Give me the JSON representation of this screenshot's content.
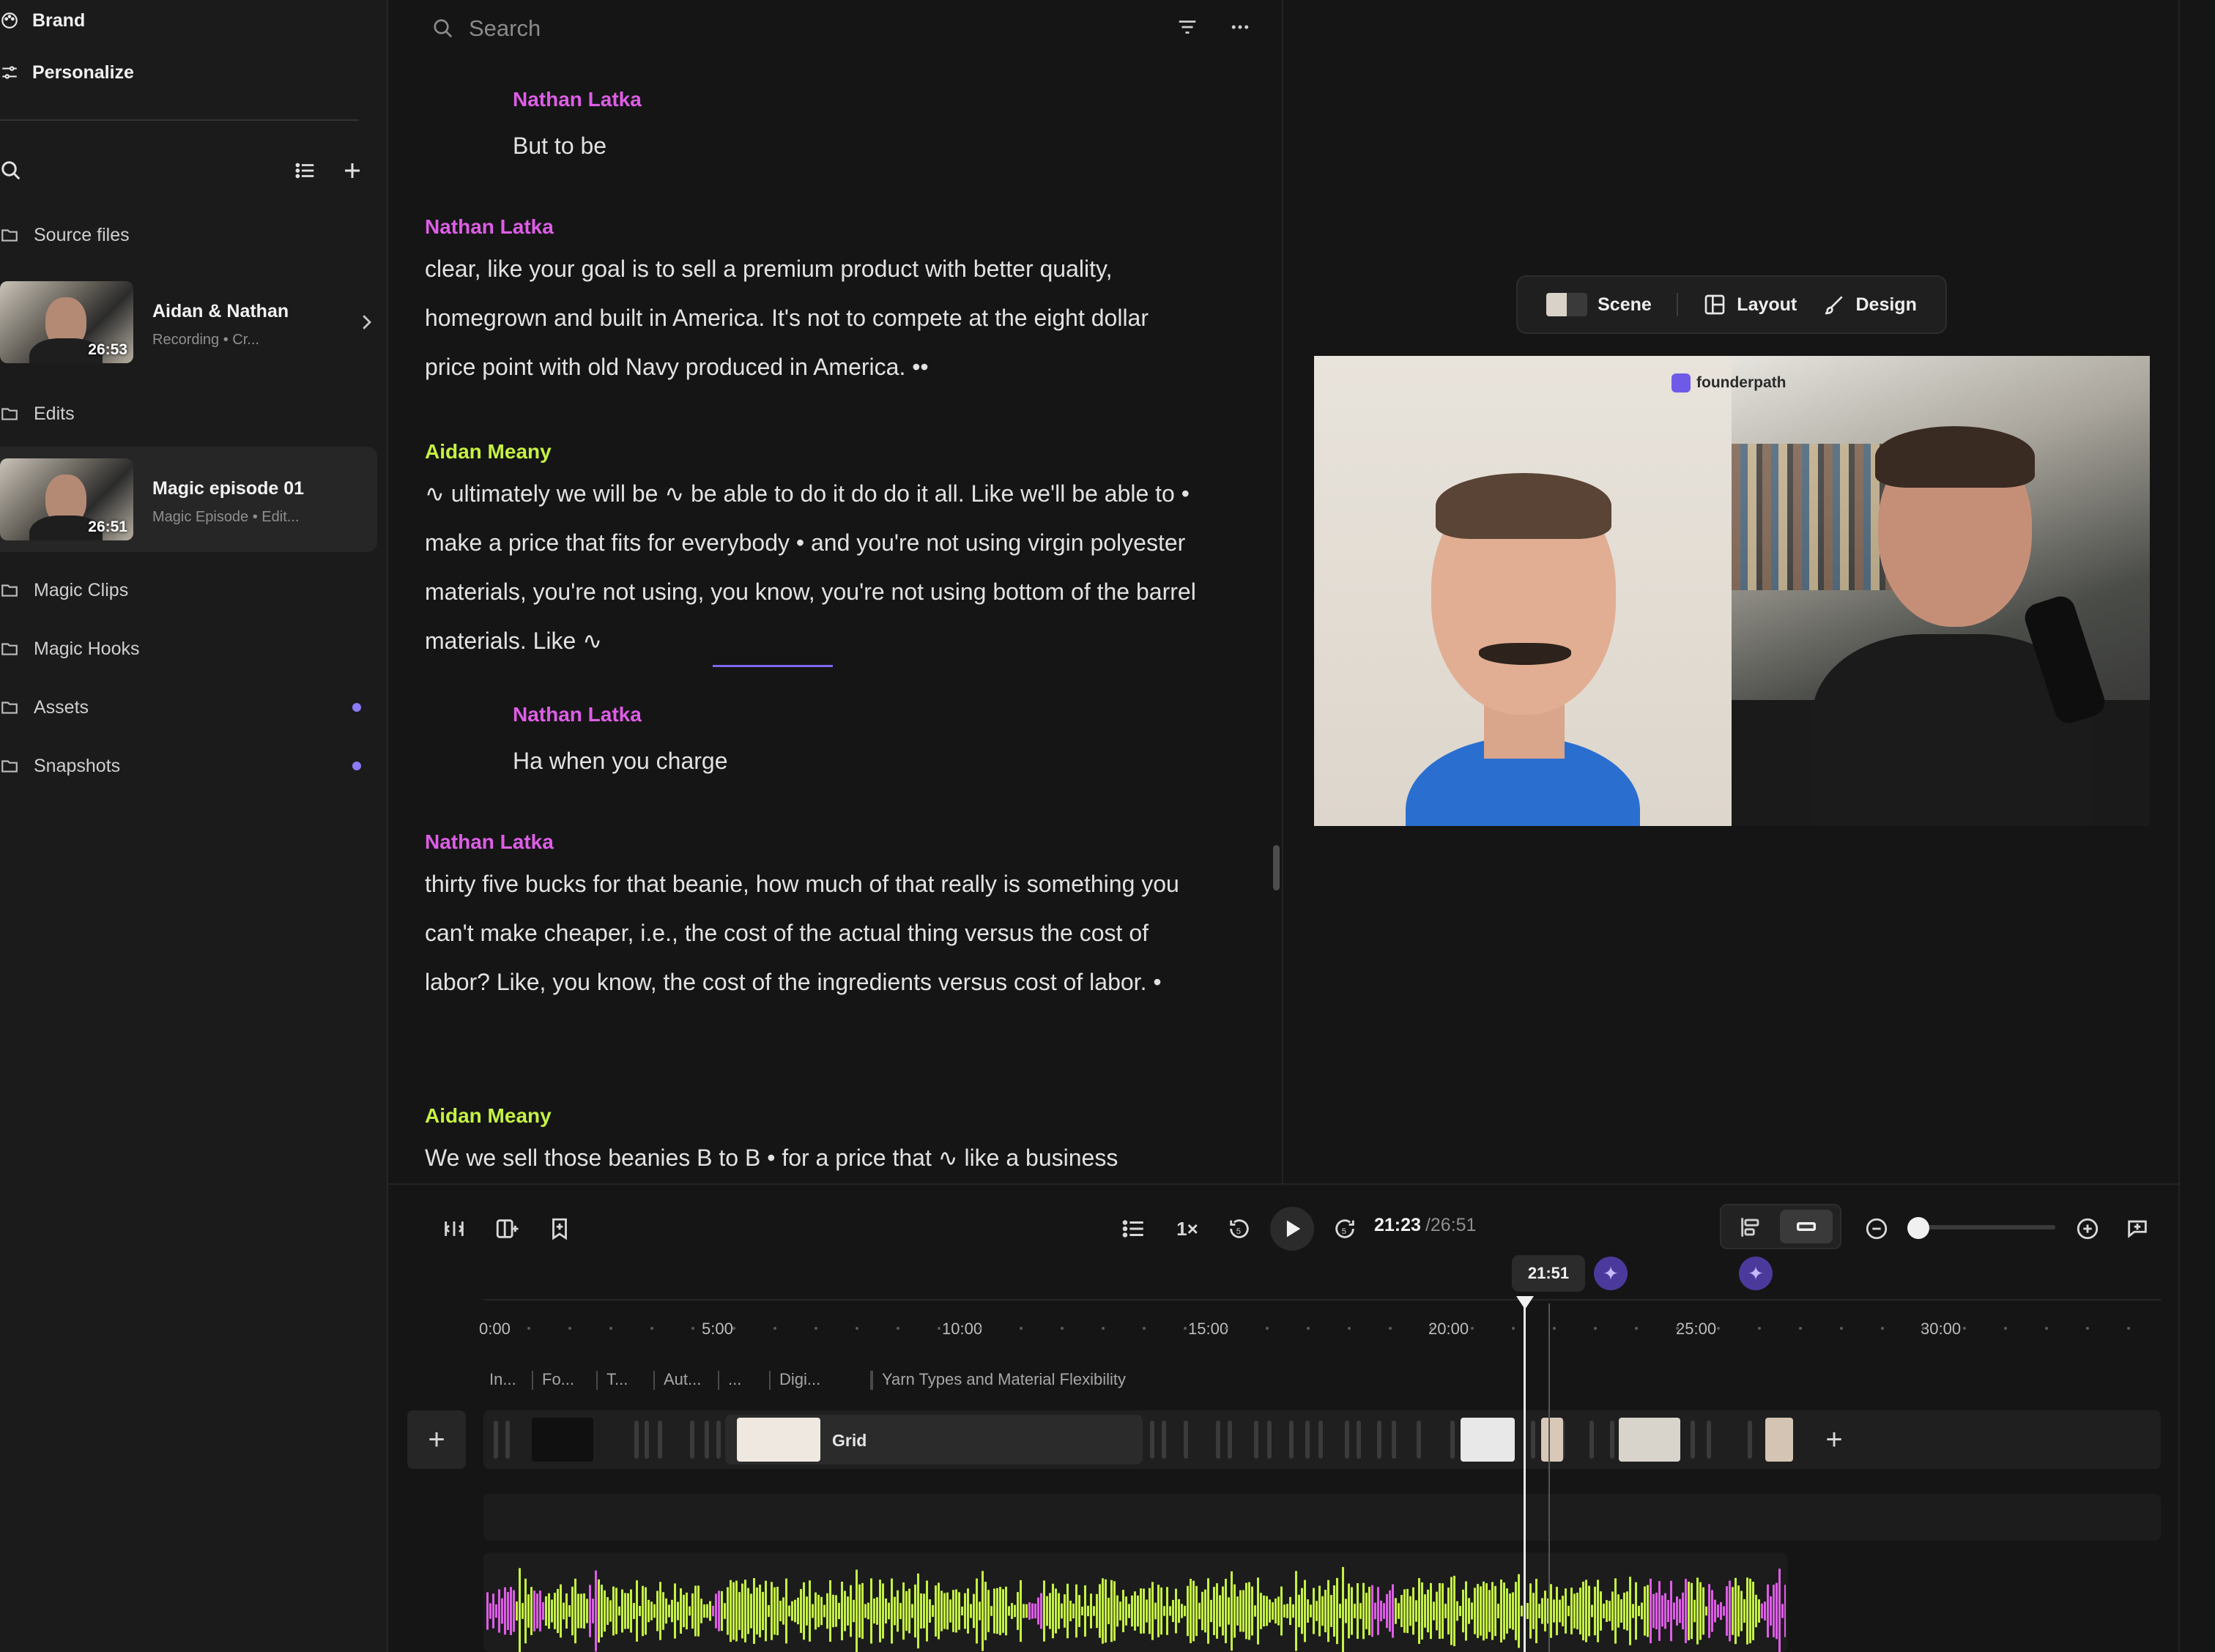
{
  "sidebar": {
    "top": [
      {
        "label": "Brand",
        "icon": "palette-icon"
      },
      {
        "label": "Personalize",
        "icon": "sliders-icon"
      }
    ],
    "sections": {
      "source_files": "Source files",
      "edits": "Edits",
      "magic_clips": "Magic Clips",
      "magic_hooks": "Magic Hooks",
      "assets": "Assets",
      "snapshots": "Snapshots"
    },
    "recording": {
      "title": "Aidan & Nathan",
      "subtitle": "Recording • Cr...",
      "duration": "26:53"
    },
    "edit_item": {
      "title": "Magic episode 01",
      "subtitle": "Magic Episode • Edit...",
      "duration": "26:51"
    }
  },
  "transcript": {
    "search_placeholder": "Search",
    "blocks": [
      {
        "speaker": "Nathan Latka",
        "text": "But to be",
        "indent": true,
        "color": "pink"
      },
      {
        "speaker": "Nathan Latka",
        "text": "clear, like your goal is to sell a premium product with better quality, homegrown and built in America. It's not to compete at the eight dollar price point with old Navy produced in America. ••",
        "indent": false,
        "color": "pink"
      },
      {
        "speaker": "Aidan Meany",
        "text": "∿ ultimately we will be ∿ be able to do it do do it all. Like we'll be able to • make a price that fits for everybody • and you're not using virgin polyester materials, you're not using, you know, you're not using bottom of the barrel materials. Like ∿",
        "indent": false,
        "color": "lime"
      },
      {
        "speaker": "Nathan Latka",
        "text": "Ha when you charge",
        "indent": true,
        "color": "pink"
      },
      {
        "speaker": "Nathan Latka",
        "text": "thirty five bucks for that beanie, how much of that really is something you can't make cheaper, i.e., the cost of the actual thing versus the cost of labor? Like, you know, the cost of the ingredients versus cost of labor. •",
        "indent": false,
        "color": "pink"
      },
      {
        "speaker": "Aidan Meany",
        "text": "We we sell those beanies B to B • for a price that ∿ like a business",
        "indent": false,
        "color": "lime"
      }
    ]
  },
  "preview": {
    "scene_label": "Scene",
    "layout_label": "Layout",
    "design_label": "Design",
    "brand_watermark": "founderpath"
  },
  "timeline": {
    "speed": "1×",
    "current_time": "21:23",
    "total_time": "/26:51",
    "hover_time": "21:51",
    "ruler": [
      "0:00",
      "5:00",
      "10:00",
      "15:00",
      "20:00",
      "25:00",
      "30:00"
    ],
    "chapters": [
      "In...",
      "Fo...",
      "T...",
      "Aut...",
      "...",
      "Digi...",
      "Yarn Types and Material Flexibility"
    ],
    "grid_clip_label": "Grid",
    "zoom_level": 0.0
  },
  "colors": {
    "pink": "#dd5ee6",
    "lime": "#c5f244",
    "accent": "#8b7bf7"
  }
}
